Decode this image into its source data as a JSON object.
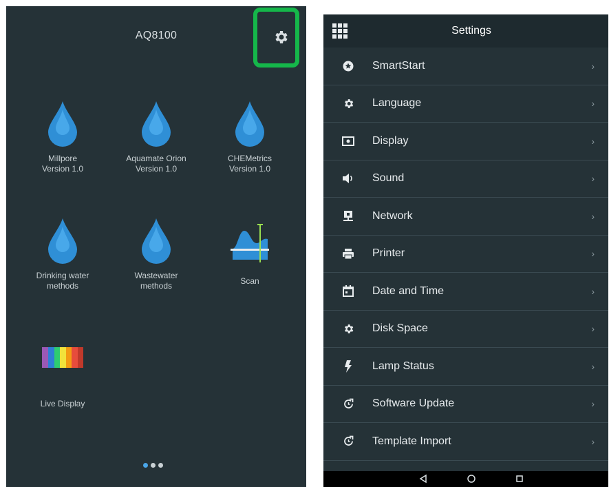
{
  "left": {
    "title": "AQ8100",
    "apps": [
      {
        "line1": "Millpore",
        "line2": "Version 1.0",
        "icon": "water-drop-icon"
      },
      {
        "line1": "Aquamate Orion",
        "line2": "Version 1.0",
        "icon": "water-drop-icon"
      },
      {
        "line1": "CHEMetrics",
        "line2": "Version 1.0",
        "icon": "water-drop-icon"
      },
      {
        "line1": "Drinking water",
        "line2": "methods",
        "icon": "water-drop-icon"
      },
      {
        "line1": "Wastewater",
        "line2": "methods",
        "icon": "water-drop-icon"
      },
      {
        "line1": "Scan",
        "line2": "",
        "icon": "scan-spectrum-icon"
      },
      {
        "line1": "Live Display",
        "line2": "",
        "icon": "rainbow-bars-icon"
      }
    ],
    "page_dots": 3,
    "active_dot": 0
  },
  "right": {
    "title": "Settings",
    "items": [
      {
        "label": "SmartStart",
        "icon": "star-circle-icon"
      },
      {
        "label": "Language",
        "icon": "gear-icon"
      },
      {
        "label": "Display",
        "icon": "display-icon"
      },
      {
        "label": "Sound",
        "icon": "speaker-icon"
      },
      {
        "label": "Network",
        "icon": "network-icon"
      },
      {
        "label": "Printer",
        "icon": "printer-icon"
      },
      {
        "label": "Date and Time",
        "icon": "calendar-icon"
      },
      {
        "label": "Disk Space",
        "icon": "gear-icon"
      },
      {
        "label": "Lamp Status",
        "icon": "lightning-icon"
      },
      {
        "label": "Software Update",
        "icon": "refresh-icon"
      },
      {
        "label": "Template Import",
        "icon": "refresh-icon"
      }
    ],
    "chevron": "›",
    "nav": {
      "back": "◁",
      "home": "○",
      "recents": "□"
    }
  },
  "colors": {
    "background": "#253237",
    "header": "#1e2a2f",
    "highlight": "#15b74a",
    "drop": "#2f8fd6",
    "accent": "#4aa6e8"
  }
}
